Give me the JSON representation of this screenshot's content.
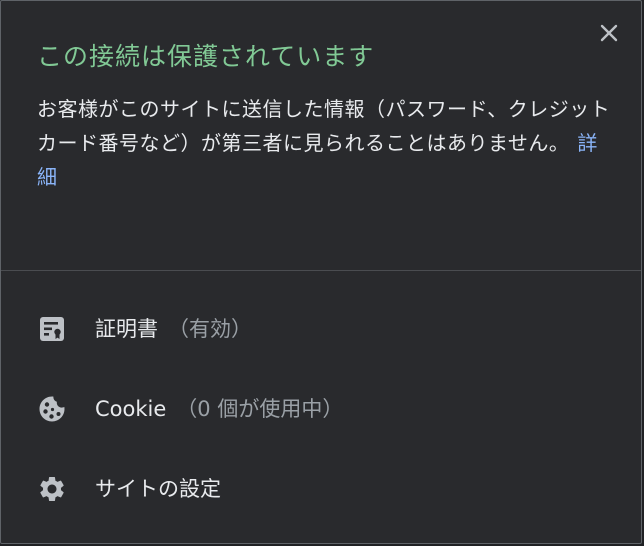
{
  "popup": {
    "title": "この接続は保護されています",
    "description": "お客様がこのサイトに送信した情報（パスワード、クレジット カード番号など）が第三者に見られることはありません。",
    "learn_more": "詳細",
    "close_icon": "close-icon"
  },
  "rows": {
    "certificate": {
      "icon": "certificate-icon",
      "label": "証明書",
      "sub": "（有効）"
    },
    "cookie": {
      "icon": "cookie-icon",
      "label": "Cookie",
      "sub": "（0 個が使用中）"
    },
    "settings": {
      "icon": "gear-icon",
      "label": "サイトの設定"
    }
  },
  "colors": {
    "title_green": "#81c995",
    "link_blue": "#8ab4f8",
    "background": "#292a2d",
    "text": "#e8eaed",
    "muted": "#9aa0a6"
  }
}
